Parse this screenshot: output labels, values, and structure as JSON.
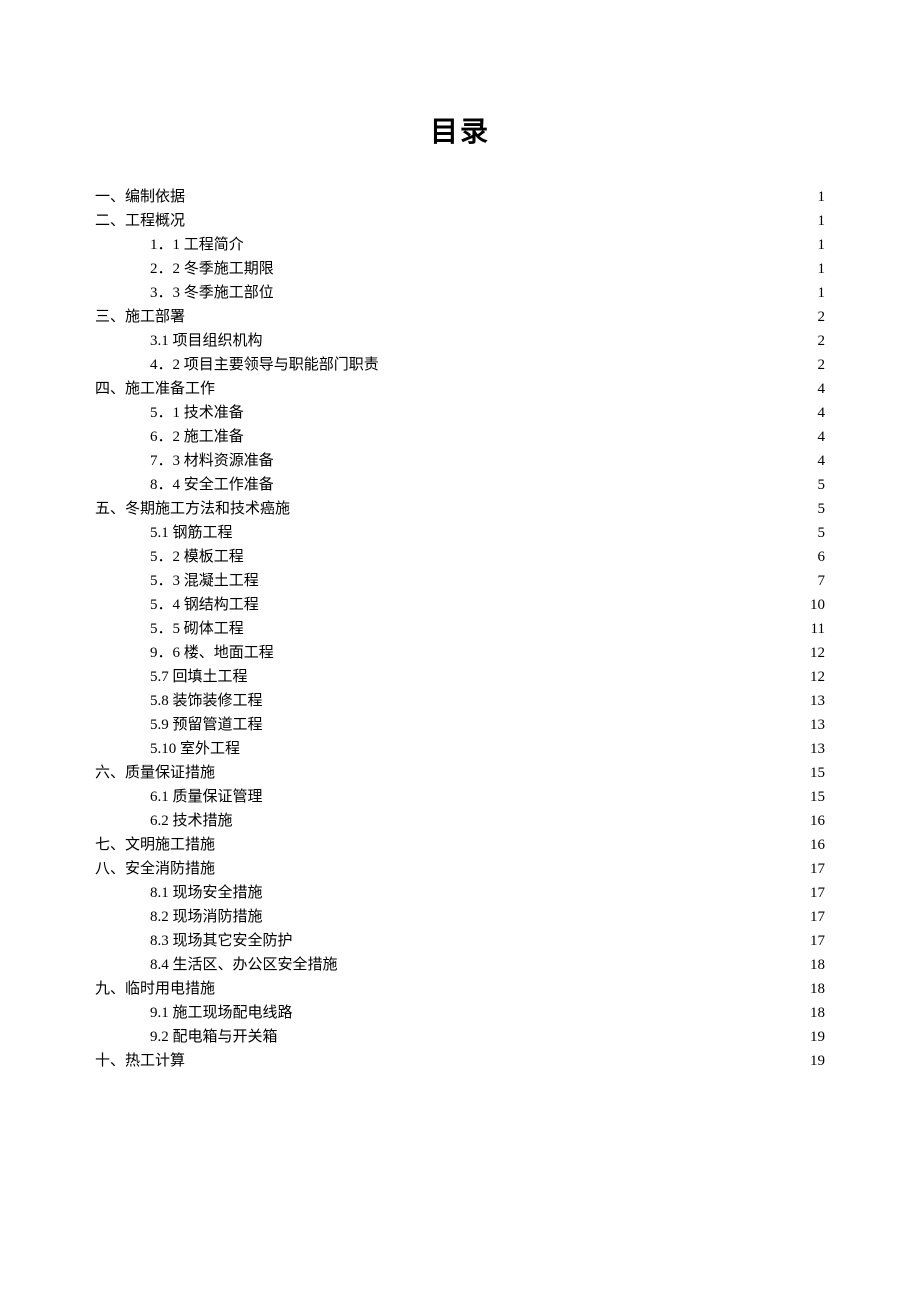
{
  "title": "目录",
  "entries": [
    {
      "level": 1,
      "label": "一、编制依据",
      "page": "1",
      "dotted": true
    },
    {
      "level": 1,
      "label": "二、工程概况",
      "page": "1",
      "dotted": true
    },
    {
      "level": 2,
      "label": "1．1 工程简介",
      "page": "1",
      "dotted": true
    },
    {
      "level": 2,
      "label": "2．2 冬季施工期限",
      "page": "1",
      "dotted": true
    },
    {
      "level": 2,
      "label": "3．3 冬季施工部位",
      "page": "1",
      "dotted": true
    },
    {
      "level": 1,
      "label": "三、施工部署",
      "page": "2",
      "dotted": true
    },
    {
      "level": 2,
      "label": "3.1  项目组织机构",
      "page": "2",
      "dotted": true
    },
    {
      "level": 2,
      "label": "4．2 项目主要领导与职能部门职责",
      "page": "2",
      "dotted": true
    },
    {
      "level": 1,
      "label": "四、施工准备工作",
      "page": "4",
      "dotted": true
    },
    {
      "level": 2,
      "label": "5．1 技术准备",
      "page": "4",
      "dotted": true
    },
    {
      "level": 2,
      "label": "6．2 施工准备",
      "page": "4",
      "dotted": true
    },
    {
      "level": 2,
      "label": "7．3 材料资源准备",
      "page": "4",
      "dotted": true
    },
    {
      "level": 2,
      "label": "8．4 安全工作准备",
      "page": "5",
      "dotted": false
    },
    {
      "level": 1,
      "label": "五、冬期施工方法和技术癌施",
      "page": "5",
      "dotted": true
    },
    {
      "level": 2,
      "label": "5.1 钢筋工程",
      "page": "5",
      "dotted": true
    },
    {
      "level": 2,
      "label": "5．2 模板工程",
      "page": "6",
      "dotted": true
    },
    {
      "level": 2,
      "label": "5．3 混凝土工程",
      "page": "7",
      "dotted": true
    },
    {
      "level": 2,
      "label": "5．4 钢结构工程",
      "page": "10",
      "dotted": true
    },
    {
      "level": 2,
      "label": "5．5 砌体工程",
      "page": "11",
      "dotted": true
    },
    {
      "level": 2,
      "label": "9．6 楼、地面工程",
      "page": "12",
      "dotted": true
    },
    {
      "level": 2,
      "label": "5.7 回填土工程",
      "page": "12",
      "dotted": true
    },
    {
      "level": 2,
      "label": "5.8 装饰装修工程",
      "page": "13",
      "dotted": true
    },
    {
      "level": 2,
      "label": "5.9 预留管道工程",
      "page": "13",
      "dotted": true
    },
    {
      "level": 2,
      "label": "5.10 室外工程",
      "page": "13",
      "dotted": true
    },
    {
      "level": 1,
      "label": "六、质量保证措施",
      "page": "15",
      "dotted": true
    },
    {
      "level": 2,
      "label": "6.1 质量保证管理",
      "page": "15",
      "dotted": true
    },
    {
      "level": 2,
      "label": "6.2 技术措施",
      "page": "16",
      "dotted": true
    },
    {
      "level": 1,
      "label": "七、文明施工措施",
      "page": "16",
      "dotted": true
    },
    {
      "level": 1,
      "label": "八、安全消防措施",
      "page": "17",
      "dotted": true
    },
    {
      "level": 2,
      "label": "8.1 现场安全措施",
      "page": "17",
      "dotted": true
    },
    {
      "level": 2,
      "label": "8.2 现场消防措施",
      "page": "17",
      "dotted": true
    },
    {
      "level": 2,
      "label": "8.3 现场其它安全防护",
      "page": "17",
      "dotted": true
    },
    {
      "level": 2,
      "label": "8.4 生活区、办公区安全措施",
      "page": "18",
      "dotted": true
    },
    {
      "level": 1,
      "label": "九、临时用电措施",
      "page": "18",
      "dotted": true
    },
    {
      "level": 2,
      "label": "9.1 施工现场配电线路",
      "page": "18",
      "dotted": true
    },
    {
      "level": 2,
      "label": "9.2 配电箱与开关箱",
      "page": "19",
      "dotted": true
    },
    {
      "level": 1,
      "label": "十、热工计算",
      "page": "19",
      "dotted": true
    }
  ]
}
